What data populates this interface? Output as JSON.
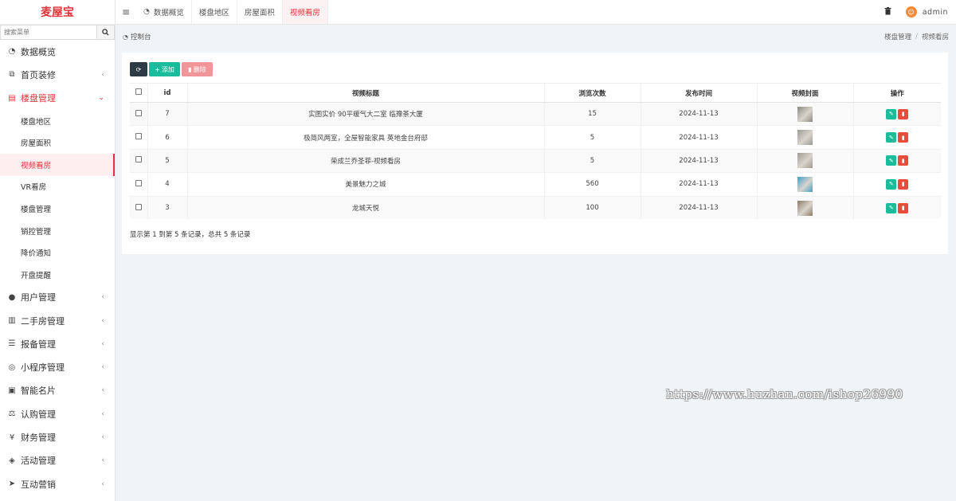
{
  "app": {
    "logo": "麦屋宝"
  },
  "search": {
    "placeholder": "搜索菜单",
    "icon": "search-icon"
  },
  "sidebar": {
    "items": [
      {
        "label": "数据概览",
        "icon": "dashboard-icon",
        "glyph": "◔"
      },
      {
        "label": "首页装修",
        "icon": "copy-icon",
        "glyph": "⧉"
      },
      {
        "label": "楼盘管理",
        "icon": "building-icon",
        "glyph": "▤"
      },
      {
        "label": "用户管理",
        "icon": "user-icon",
        "glyph": "●"
      },
      {
        "label": "二手房管理",
        "icon": "building-alt-icon",
        "glyph": "▥"
      },
      {
        "label": "报备管理",
        "icon": "database-icon",
        "glyph": "☰"
      },
      {
        "label": "小程序管理",
        "icon": "wechat-icon",
        "glyph": "◎"
      },
      {
        "label": "智能名片",
        "icon": "id-card-icon",
        "glyph": "▣"
      },
      {
        "label": "认购管理",
        "icon": "balance-icon",
        "glyph": "⚖"
      },
      {
        "label": "财务管理",
        "icon": "yen-icon",
        "glyph": "¥"
      },
      {
        "label": "活动管理",
        "icon": "handshake-icon",
        "glyph": "◈"
      },
      {
        "label": "互动营销",
        "icon": "paper-plane-icon",
        "glyph": "➤"
      }
    ],
    "subitems": [
      "楼盘地区",
      "房屋面积",
      "视频看房",
      "VR看房",
      "楼盘管理",
      "销控管理",
      "降价通知",
      "开盘提醒"
    ]
  },
  "topnav": {
    "tabs": [
      "数据概览",
      "楼盘地区",
      "房屋面积",
      "视频看房"
    ],
    "user": "admin"
  },
  "breadcrumb": {
    "left": "控制台",
    "right": [
      "楼盘管理",
      "视频看房"
    ]
  },
  "toolbar": {
    "add_label": "添加",
    "delete_label": "删除"
  },
  "table": {
    "headers": [
      "id",
      "视频标题",
      "浏览次数",
      "发布时间",
      "视频封面",
      "操作"
    ],
    "rows": [
      {
        "id": "7",
        "title": "实图实价 90平暖气大二室 临豫茶大厦",
        "views": "15",
        "date": "2024-11-13",
        "cover": "#8a8a80"
      },
      {
        "id": "6",
        "title": "极简风两室，全屋智能家具 英地金台府邸",
        "views": "5",
        "date": "2024-11-13",
        "cover": "#9a9a96"
      },
      {
        "id": "5",
        "title": "荣成兰乔圣菲-视频看房",
        "views": "5",
        "date": "2024-11-13",
        "cover": "#a09a90"
      },
      {
        "id": "4",
        "title": "美景魅力之城",
        "views": "560",
        "date": "2024-11-13",
        "cover": "#3fa0c8"
      },
      {
        "id": "3",
        "title": "龙城天悦",
        "views": "100",
        "date": "2024-11-13",
        "cover": "#8d7a66"
      }
    ]
  },
  "summary": "显示第 1 到第 5 条记录，总共 5 条记录",
  "watermark": "https://www.huzhan.com/ishop26990",
  "colors": {
    "accent": "#e0333a",
    "add": "#1abc9c",
    "delete": "#f0969a",
    "refresh": "#2c3b44",
    "remove": "#e74c3c"
  }
}
